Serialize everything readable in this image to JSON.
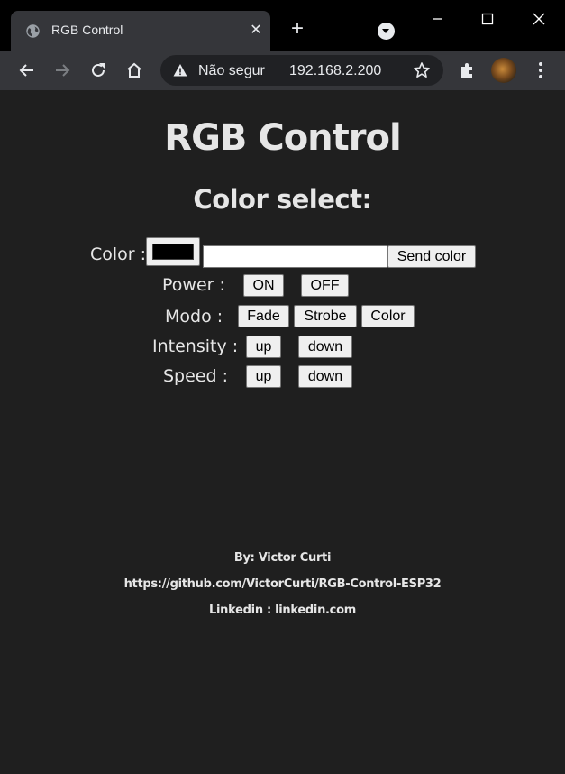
{
  "browser": {
    "tab_title": "RGB Control",
    "tab_close": "✕",
    "new_tab": "+",
    "omnibox": {
      "security_text": "Não segur",
      "url": "192.168.2.200"
    },
    "icons": [
      "globe-icon",
      "back-icon",
      "forward-icon",
      "reload-icon",
      "home-icon",
      "warning-icon",
      "star-icon",
      "extensions-icon",
      "menu-icon",
      "minimize-icon",
      "maximize-icon",
      "close-icon"
    ]
  },
  "page": {
    "title": "RGB Control",
    "subtitle": "Color select:",
    "color_row": {
      "label": "Color :",
      "swatch_color": "#000000",
      "text_value": "",
      "send_label": "Send color"
    },
    "power_row": {
      "label": "Power :",
      "on_label": "ON",
      "off_label": "OFF"
    },
    "mode_row": {
      "label": "Modo :",
      "fade_label": "Fade",
      "strobe_label": "Strobe",
      "color_label": "Color"
    },
    "intensity_row": {
      "label": "Intensity :",
      "up_label": "up",
      "down_label": "down"
    },
    "speed_row": {
      "label": "Speed :",
      "up_label": "up",
      "down_label": "down"
    },
    "footer": {
      "author": "By: Victor Curti",
      "repo": "https://github.com/VictorCurti/RGB-Control-ESP32",
      "linkedin": "Linkedin : linkedin.com"
    }
  },
  "colors": {
    "page_background": "#1f1f1f",
    "text": "#e6e6e6",
    "button_background": "#efefef"
  }
}
